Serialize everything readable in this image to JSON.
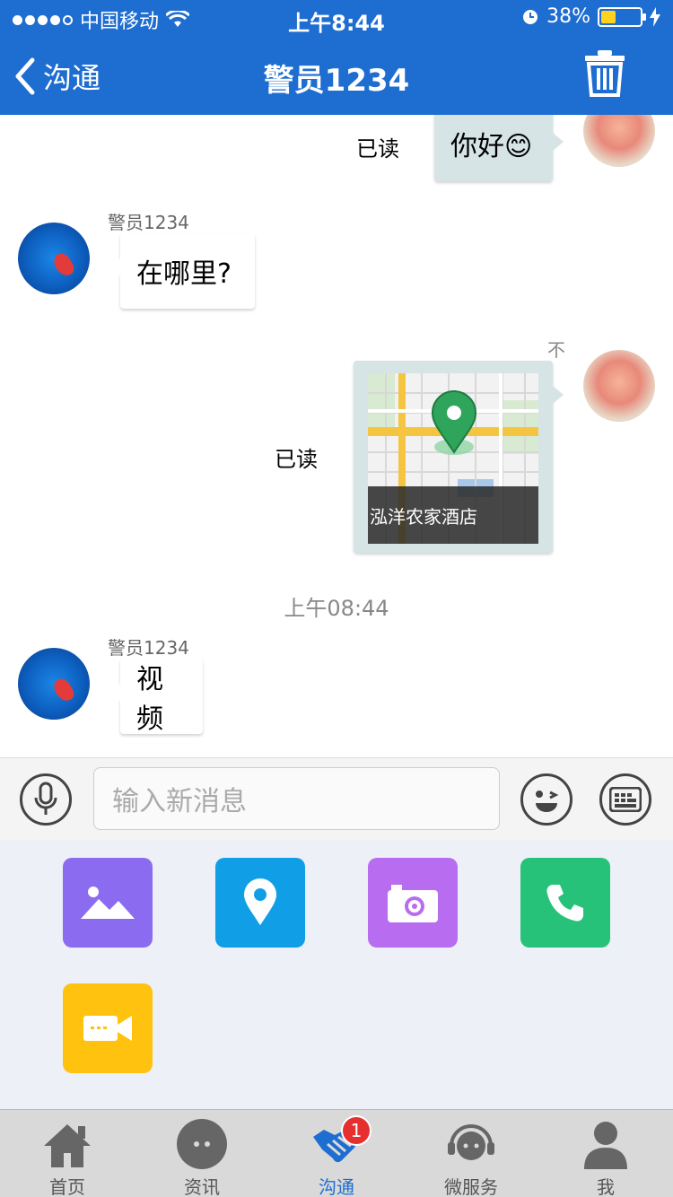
{
  "status_bar": {
    "carrier": "中国移动",
    "time": "上午8:44",
    "battery": "38%"
  },
  "nav": {
    "back_label": "沟通",
    "title": "警员1234"
  },
  "messages": [
    {
      "side": "right",
      "text": "你好😊",
      "receipt": "已读"
    },
    {
      "side": "left",
      "sender": "警员1234",
      "text": "在哪里?"
    },
    {
      "side": "right",
      "type": "location",
      "place": "泓洋农家酒店",
      "receipt": "已读",
      "note": "不"
    },
    {
      "type": "timestamp",
      "text": "上午08:44"
    },
    {
      "side": "left",
      "sender": "警员1234",
      "text": "视频"
    }
  ],
  "input": {
    "placeholder": "输入新消息"
  },
  "tools": [
    {
      "icon": "image-icon",
      "color": "#8b6cf0"
    },
    {
      "icon": "location-icon",
      "color": "#109fe6"
    },
    {
      "icon": "camera-icon",
      "color": "#b86cf0"
    },
    {
      "icon": "phone-icon",
      "color": "#27c27a"
    },
    {
      "icon": "video-icon",
      "color": "#ffc20e"
    }
  ],
  "tabs": [
    {
      "label": "首页",
      "icon": "home-icon"
    },
    {
      "label": "资讯",
      "icon": "chat-bubble-icon"
    },
    {
      "label": "沟通",
      "icon": "handshake-icon",
      "active": true,
      "badge": "1"
    },
    {
      "label": "微服务",
      "icon": "headset-icon"
    },
    {
      "label": "我",
      "icon": "person-icon"
    }
  ]
}
